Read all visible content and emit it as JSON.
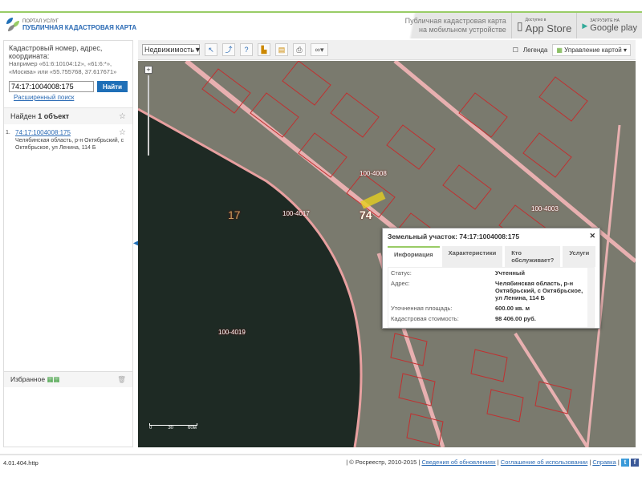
{
  "header": {
    "logo_top": "ПОРТАЛ УСЛУГ",
    "logo_main": "ПУБЛИЧНАЯ КАДАСТРОВАЯ КАРТА",
    "mobile_text_1": "Публичная кадастровая карта",
    "mobile_text_2": "на мобильном устройстве",
    "appstore_small": "Доступно в",
    "appstore": "App Store",
    "gplay_small": "ЗАГРУЗИТЕ НА",
    "gplay": "Google play"
  },
  "search": {
    "label": "Кадастровый номер, адрес, координата:",
    "hint1": "Например «61:6:10104:12», «61:6:*»,",
    "hint2": "«Москва» или «55.755768, 37.617671»",
    "value": "74:17:1004008:175",
    "button": "Найти",
    "advanced": "Расширенный поиск"
  },
  "results": {
    "found_prefix": "Найден ",
    "found_count": "1 объект",
    "items": [
      {
        "num": "1.",
        "id": "74:17:1004008:175",
        "address": "Челябинская область, р-н Октябрьский, с Октябрьское, ул Ленина, 114 Б"
      }
    ]
  },
  "favorites": {
    "label": "Избранное"
  },
  "toolbar": {
    "layer_select": "Недвижимость",
    "legend": "Легенда",
    "map_control": "Управление картой"
  },
  "map": {
    "labels": [
      "17",
      "100-4017",
      "100-4008",
      "100-4003",
      "100-4019",
      "74"
    ],
    "scale": [
      "0",
      "30",
      "60м"
    ]
  },
  "popup": {
    "title": "Земельный участок: 74:17:1004008:175",
    "tabs": [
      "Информация",
      "Характеристики",
      "Кто обслуживает?",
      "Услуги"
    ],
    "rows": [
      {
        "k": "Статус:",
        "v": "Учтенный"
      },
      {
        "k": "Адрес:",
        "v": "Челябинская область, р-н Октябрьский, с Октябрьское, ул Ленина, 114 Б"
      },
      {
        "k": "Уточненная площадь:",
        "v": "600.00 кв. м"
      },
      {
        "k": "Кадастровая стоимость:",
        "v": "98 406.00 руб."
      }
    ]
  },
  "footer": {
    "version": "4.01.404.http",
    "copyright": "| © Росреестр, 2010-2015 |",
    "link1": "Сведения об обновлениях",
    "link2": "Соглашение об использовании",
    "link3": "Справка"
  },
  "colors": {
    "accent": "#1f6fb7",
    "green": "#99cc66",
    "parcel": "#d03030"
  }
}
